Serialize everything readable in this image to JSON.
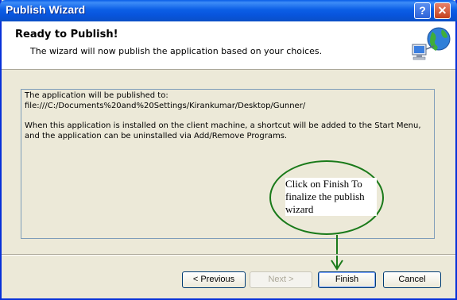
{
  "window": {
    "title": "Publish Wizard"
  },
  "titlebar": {
    "help_label": "?",
    "close_label": "✕"
  },
  "header": {
    "title": "Ready to Publish!",
    "subtitle": "The wizard will now publish the application based on your choices.",
    "icon": "network-globe-icon"
  },
  "content": {
    "line1": "The application will be published to:",
    "line2": "file:///C:/Documents%20and%20Settings/Kirankumar/Desktop/Gunner/",
    "paragraph": "When this application is installed on the client machine, a shortcut will be added to the Start Menu, and the application can be uninstalled via Add/Remove Programs."
  },
  "annotation": {
    "text": "Click on Finish To finalize the publish wizard",
    "color": "#1a7a1a"
  },
  "buttons": {
    "previous": "< Previous",
    "next": "Next >",
    "finish": "Finish",
    "cancel": "Cancel"
  },
  "colors": {
    "title_bar": "#0a5ee8",
    "window_bg": "#ece9d8",
    "annotation": "#1a7a1a"
  }
}
